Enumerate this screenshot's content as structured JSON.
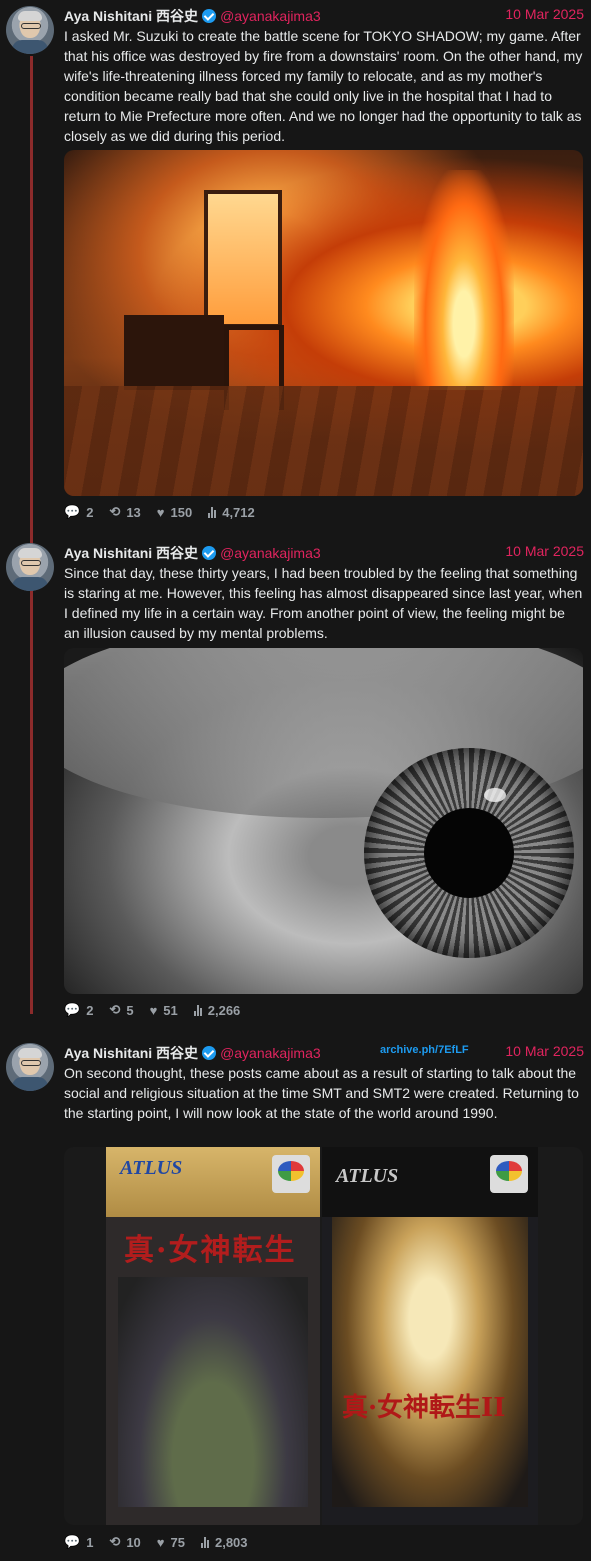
{
  "tweets": [
    {
      "author": "Aya Nishitani 西谷史",
      "handle": "@ayanakajima3",
      "date": "10 Mar 2025",
      "text": "I asked Mr. Suzuki to create the battle scene for TOKYO SHADOW; my game. After that his office was destroyed by fire from a downstairs' room. On the other hand, my wife's life-threatening illness forced my family to relocate, and as my mother's condition became really bad that she could only live in the hospital that I had to return to Mie Prefecture more often. And we no longer had the opportunity to talk as closely as we did during this period.",
      "stats": {
        "replies": "2",
        "reposts": "13",
        "likes": "150",
        "views": "4,712"
      }
    },
    {
      "author": "Aya Nishitani 西谷史",
      "handle": "@ayanakajima3",
      "date": "10 Mar 2025",
      "text": "Since that day, these thirty years, I had been troubled by the feeling that something is staring at me. However, this feeling has almost disappeared since last year, when I defined my life in a certain way. From another point of view, the feeling might be an illusion caused by my mental problems.",
      "stats": {
        "replies": "2",
        "reposts": "5",
        "likes": "51",
        "views": "2,266"
      }
    },
    {
      "author": "Aya Nishitani 西谷史",
      "handle": "@ayanakajima3",
      "archive": "archive.ph/7EfLF",
      "date": "10 Mar 2025",
      "text": "On second thought, these posts came about as a result of starting to talk about the social and religious situation at the time SMT and SMT2 were created. Returning to the starting point, I will now look at the state of the world around 1990.",
      "media": {
        "box1_logo": "ATLUS",
        "box1_title": "真·女神転生",
        "box2_logo": "ATLUS",
        "box2_title": "真·女神転生II"
      },
      "stats": {
        "replies": "1",
        "reposts": "10",
        "likes": "75",
        "views": "2,803"
      }
    }
  ],
  "colors": {
    "background": "#161616",
    "accent": "#e0245e",
    "verified": "#1d9bf0",
    "thread_line": "#8c2b2b"
  }
}
